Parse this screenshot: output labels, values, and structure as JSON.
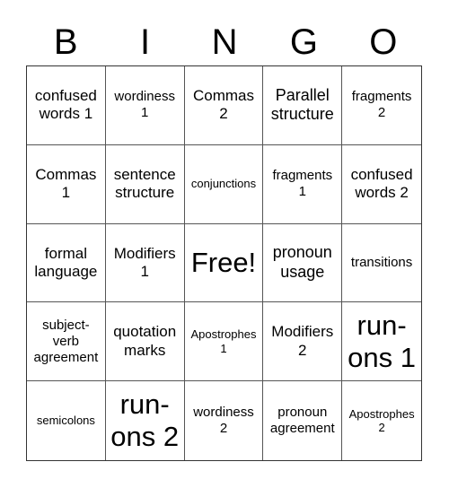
{
  "header": [
    "B",
    "I",
    "N",
    "G",
    "O"
  ],
  "cells": [
    {
      "text": "confused\nwords 1",
      "size": "s17"
    },
    {
      "text": "wordiness\n1",
      "size": "s15"
    },
    {
      "text": "Commas\n2",
      "size": "s17"
    },
    {
      "text": "Parallel\nstructure",
      "size": "s18"
    },
    {
      "text": "fragments\n2",
      "size": "s15"
    },
    {
      "text": "Commas\n1",
      "size": "s17"
    },
    {
      "text": "sentence\nstructure",
      "size": "s17"
    },
    {
      "text": "conjunctions",
      "size": "s13"
    },
    {
      "text": "fragments\n1",
      "size": "s15"
    },
    {
      "text": "confused\nwords 2",
      "size": "s17"
    },
    {
      "text": "formal\nlanguage",
      "size": "s17"
    },
    {
      "text": "Modifiers\n1",
      "size": "s17"
    },
    {
      "text": "Free!",
      "size": "s32"
    },
    {
      "text": "pronoun\nusage",
      "size": "s18"
    },
    {
      "text": "transitions",
      "size": "s15"
    },
    {
      "text": "subject-\nverb\nagreement",
      "size": "s15"
    },
    {
      "text": "quotation\nmarks",
      "size": "s17"
    },
    {
      "text": "Apostrophes\n1",
      "size": "s13"
    },
    {
      "text": "Modifiers\n2",
      "size": "s17"
    },
    {
      "text": "run-\nons 1",
      "size": "s32"
    },
    {
      "text": "semicolons",
      "size": "s13"
    },
    {
      "text": "run-\nons 2",
      "size": "s32"
    },
    {
      "text": "wordiness\n2",
      "size": "s15"
    },
    {
      "text": "pronoun\nagreement",
      "size": "s15"
    },
    {
      "text": "Apostrophes\n2",
      "size": "s13"
    }
  ]
}
